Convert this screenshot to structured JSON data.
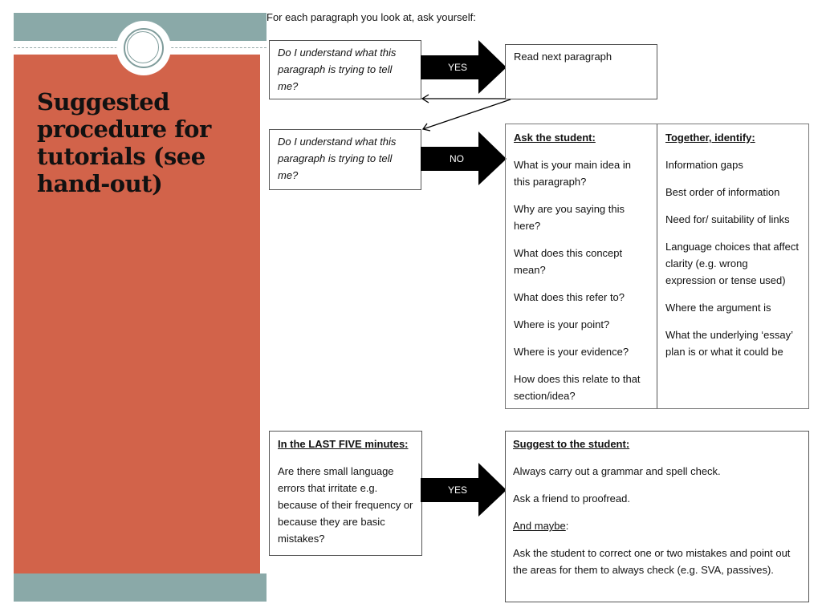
{
  "slide": {
    "title": "Suggested procedure for tutorials (see hand-out)",
    "colors": {
      "accent_orange": "#d2634a",
      "accent_teal": "#8aa9a8"
    }
  },
  "intro": "For each paragraph you look at, ask yourself:",
  "flow": {
    "question_top": "Do I understand what this paragraph is trying to tell me?",
    "question_bottom": "Do I understand what this paragraph is trying to tell me?",
    "arrow_yes_top": "YES",
    "arrow_no": "NO",
    "arrow_yes_bottom": "YES",
    "read_next": "Read next paragraph"
  },
  "ask_student": {
    "heading": "Ask the student:",
    "items": [
      "What is your main idea in this paragraph?",
      "Why are you saying this here?",
      "What does this concept mean?",
      "What does this refer to?",
      "Where is your point?",
      "Where is your evidence?",
      "How does this relate to that section/idea?"
    ]
  },
  "together": {
    "heading": "Together, identify:",
    "items": [
      "Information gaps",
      "Best order of information",
      "Need for/ suitability of links",
      "Language choices that affect clarity (e.g. wrong expression or tense used)",
      "Where the argument is",
      "What the underlying ‘essay’ plan is or what it could be"
    ]
  },
  "last_five": {
    "heading": "In the LAST FIVE minutes:",
    "body": "Are there small language errors that irritate e.g. because of their frequency or because they are basic mistakes?"
  },
  "suggest": {
    "heading": "Suggest to the student:",
    "items": [
      "Always carry out a grammar and spell check.",
      "Ask a friend to proofread."
    ],
    "maybe_label": "And maybe",
    "maybe_suffix": ":",
    "final": "Ask the student to correct one or two mistakes and point out the areas for them to always check (e.g. SVA, passives)."
  }
}
